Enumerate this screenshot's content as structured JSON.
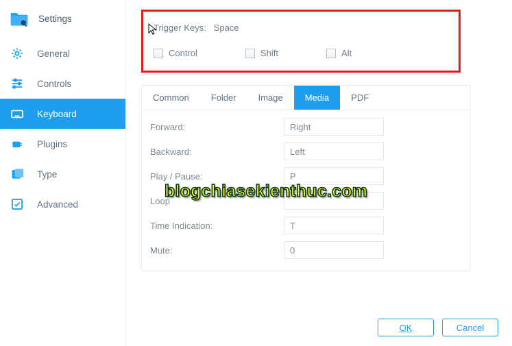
{
  "sidebar": {
    "title": "Settings",
    "items": [
      {
        "label": "General",
        "icon": "gear-icon"
      },
      {
        "label": "Controls",
        "icon": "sliders-icon"
      },
      {
        "label": "Keyboard",
        "icon": "keyboard-icon"
      },
      {
        "label": "Plugins",
        "icon": "plugin-icon"
      },
      {
        "label": "Type",
        "icon": "type-icon"
      },
      {
        "label": "Advanced",
        "icon": "check-square-icon"
      }
    ],
    "active_index": 2
  },
  "trigger": {
    "label": "Trigger Keys:",
    "value": "Space",
    "modifiers": [
      {
        "label": "Control",
        "checked": false
      },
      {
        "label": "Shift",
        "checked": false
      },
      {
        "label": "Alt",
        "checked": false
      }
    ]
  },
  "tabs": {
    "items": [
      "Common",
      "Folder",
      "Image",
      "Media",
      "PDF"
    ],
    "active_index": 3
  },
  "keybindings": [
    {
      "label": "Forward:",
      "value": "Right"
    },
    {
      "label": "Backward:",
      "value": "Left"
    },
    {
      "label": "Play / Pause:",
      "value": "P"
    },
    {
      "label": "Loop",
      "value": ""
    },
    {
      "label": "Time Indication:",
      "value": "T"
    },
    {
      "label": "Mute:",
      "value": "0"
    }
  ],
  "footer": {
    "ok": "OK",
    "cancel": "Cancel"
  },
  "watermark": "blogchiasekienthuc.com"
}
